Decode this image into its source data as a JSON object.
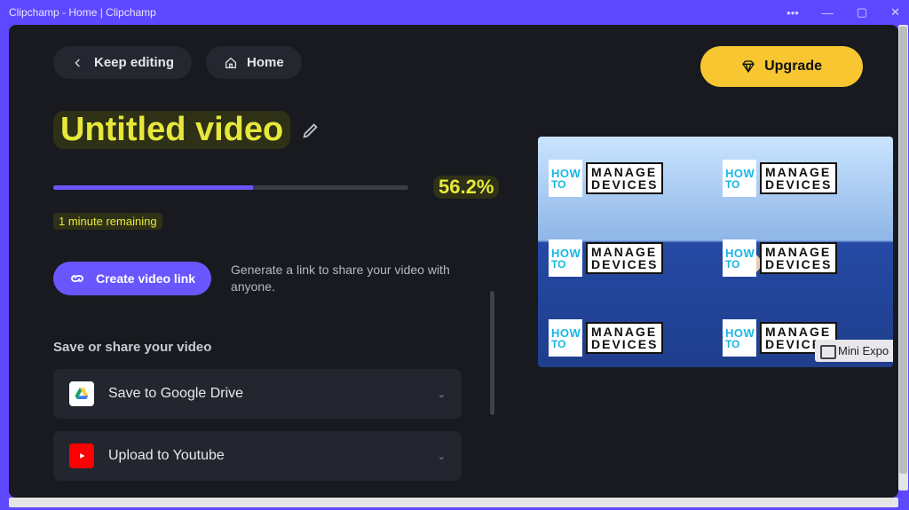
{
  "window": {
    "title": "Clipchamp - Home | Clipchamp"
  },
  "header": {
    "keep_editing": "Keep editing",
    "home": "Home",
    "upgrade": "Upgrade"
  },
  "video": {
    "title": "Untitled video"
  },
  "progress": {
    "percent_label": "56.2%",
    "fill_pct": "56.2%",
    "remaining": "1 minute remaining"
  },
  "link": {
    "cta": "Create video link",
    "description": "Generate a link to share your video with anyone."
  },
  "share": {
    "section_label": "Save or share your video",
    "options": [
      {
        "label": "Save to Google Drive"
      },
      {
        "label": "Upload to Youtube"
      }
    ]
  },
  "preview": {
    "tile_how": "HOW",
    "tile_to": "TO",
    "tile_l1": "MANAGE",
    "tile_l2": "DEVICES",
    "mini_label": "Mini Expo"
  }
}
